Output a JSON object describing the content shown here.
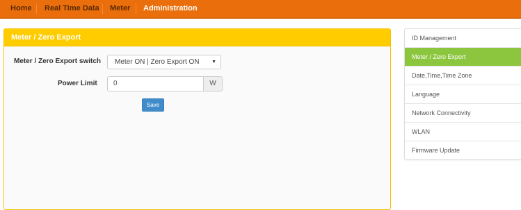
{
  "nav": {
    "items": [
      {
        "label": "Home"
      },
      {
        "label": "Real Time Data"
      },
      {
        "label": "Meter"
      },
      {
        "label": "Administration",
        "active": true
      }
    ]
  },
  "panel": {
    "title": "Meter / Zero Export",
    "switch_label": "Meter / Zero Export switch",
    "switch_value": "Meter ON | Zero Export ON",
    "power_limit_label": "Power Limit",
    "power_limit_value": "0",
    "power_limit_unit": "W",
    "save_label": "Save"
  },
  "sidebar": {
    "items": [
      {
        "label": "ID Management"
      },
      {
        "label": "Meter / Zero Export",
        "active": true
      },
      {
        "label": "Date,Time,Time Zone"
      },
      {
        "label": "Language"
      },
      {
        "label": "Network Connectivity"
      },
      {
        "label": "WLAN"
      },
      {
        "label": "Firmware Update"
      }
    ]
  },
  "colors": {
    "nav_bg": "#ea6f0c",
    "panel_header": "#ffcc00",
    "sidebar_active": "#8cc63f",
    "button": "#428bca"
  },
  "icons": {
    "select_caret": "caret-down-icon"
  }
}
